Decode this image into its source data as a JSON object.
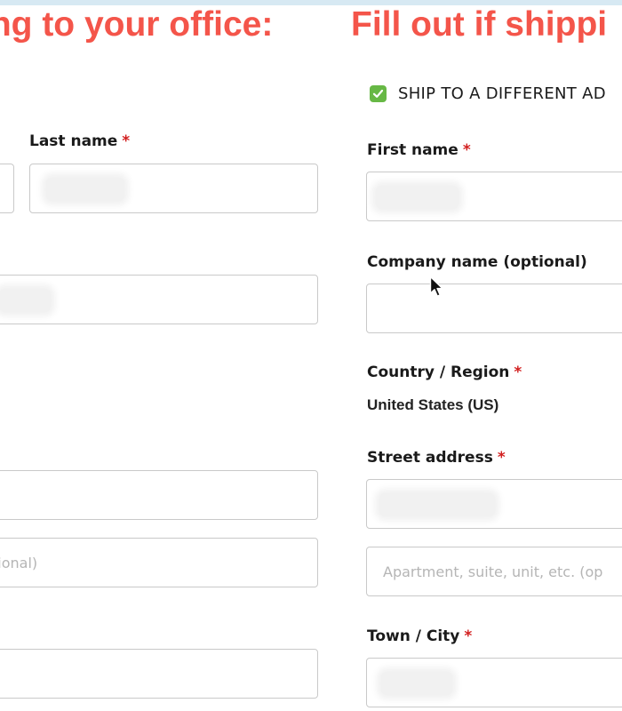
{
  "headings": {
    "left": "ing to your office:",
    "right": "Fill out if shippi"
  },
  "colors": {
    "heading": "#f4554a",
    "required_asterisk": "#d21f1f",
    "checkbox": "#67b845",
    "field_border": "#c9c9c9"
  },
  "left_form": {
    "last_name_label": "Last name",
    "last_name_required": "*",
    "address_line_2_placeholder": "tional)"
  },
  "right_form": {
    "ship_different_checked": true,
    "ship_different_label": "SHIP TO A DIFFERENT AD",
    "first_name_label": "First name",
    "first_name_required": "*",
    "company_label": "Company name (optional)",
    "country_label": "Country / Region",
    "country_required": "*",
    "country_value": "United States (US)",
    "street_label": "Street address",
    "street_required": "*",
    "apartment_placeholder": "Apartment, suite, unit, etc. (op",
    "town_label": "Town / City",
    "town_required": "*"
  },
  "icons": {
    "checkbox": "check-icon",
    "pointer": "mouse-pointer-icon"
  }
}
